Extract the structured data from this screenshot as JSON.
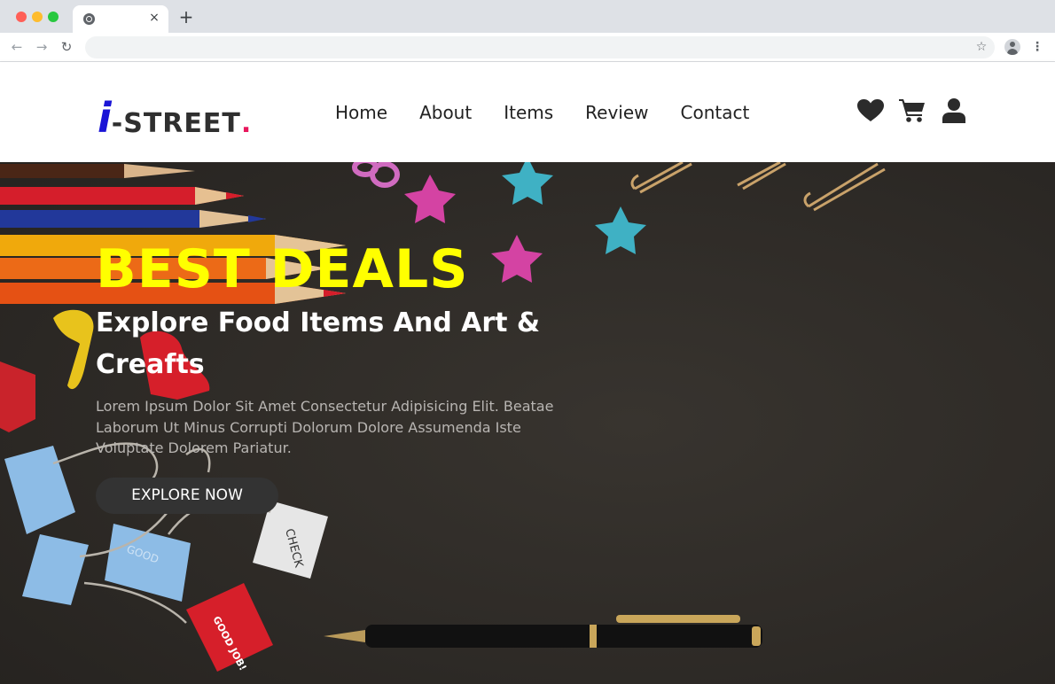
{
  "browser": {
    "tab_close": "×",
    "new_tab": "+",
    "back": "←",
    "forward": "→",
    "reload": "↻",
    "star": "☆",
    "menu": "⋮"
  },
  "header": {
    "logo": {
      "i": "i",
      "text": "-STREET",
      "dot": "."
    },
    "nav": [
      "Home",
      "About",
      "Items",
      "Review",
      "Contact"
    ],
    "icons": [
      "heart-icon",
      "cart-icon",
      "user-icon"
    ]
  },
  "hero": {
    "title": "BEST DEALS",
    "subtitle": "Explore Food Items And Art & Creafts",
    "description": "Lorem Ipsum Dolor Sit Amet Consectetur Adipisicing Elit. Beatae Laborum Ut Minus Corrupti Dolorum Dolore Assumenda Iste Voluptate Dolorem Pariatur.",
    "button": "EXPLORE NOW",
    "clip_labels": [
      "CHECK",
      "GOOD",
      "GOOD JOB!"
    ]
  },
  "colors": {
    "logo_i": "#1a14d6",
    "logo_dot": "#e8175d",
    "hero_title": "#ffff00",
    "hero_bg": "#2e2b28",
    "button_bg": "#333333"
  }
}
